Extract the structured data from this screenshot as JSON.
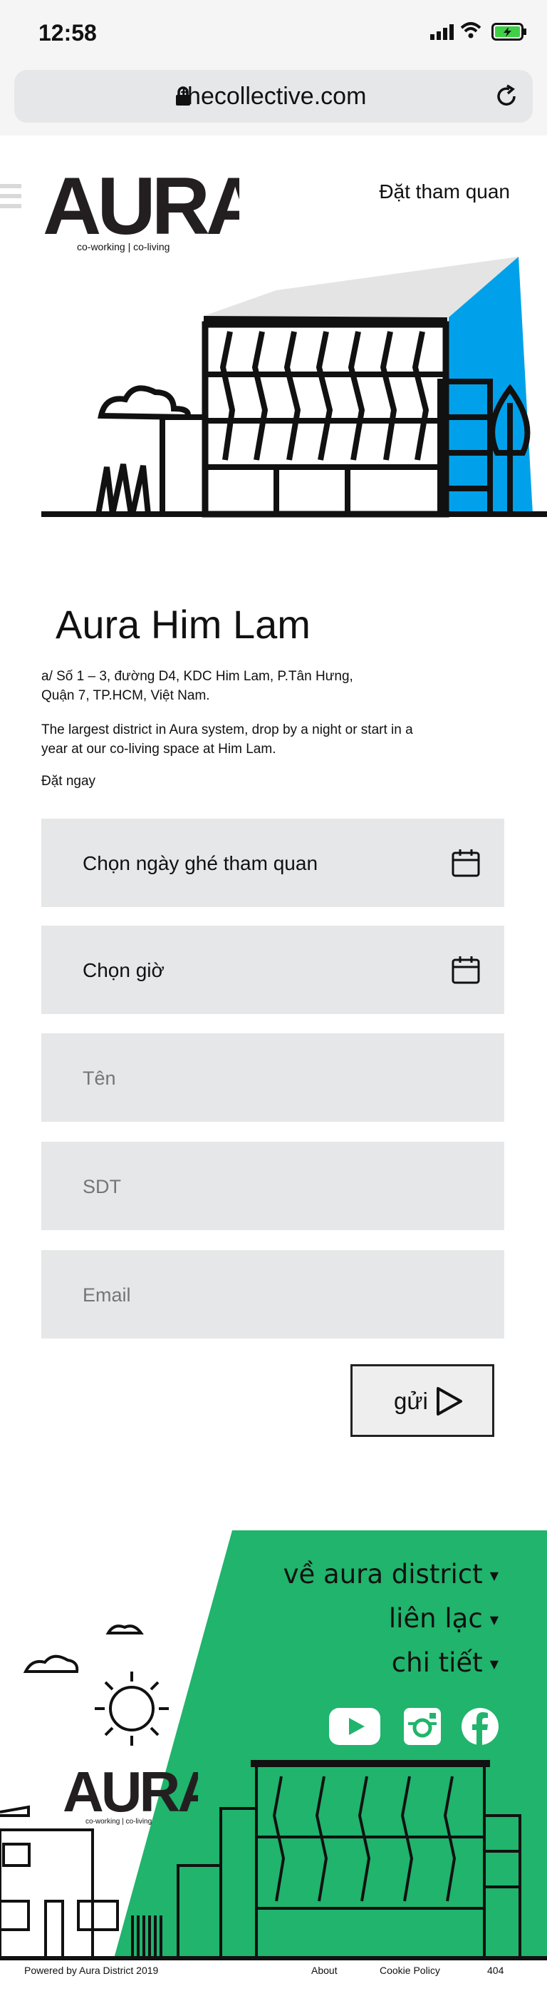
{
  "status": {
    "time": "12:58"
  },
  "browser": {
    "url": "thecollective.com"
  },
  "header": {
    "logo_text": "AURA",
    "tagline": "co-working  |  co-living",
    "tour_link": "Đặt tham quan"
  },
  "location": {
    "title": "Aura Him Lam",
    "address_line1": "a/ Số 1 – 3, đường D4, KDC Him Lam, P.Tân Hưng,",
    "address_line2": "Quận 7, TP.HCM, Việt Nam.",
    "description_line1": "The largest district in Aura system, drop by a night or start in a",
    "description_line2": "year at our co-living space at Him Lam.",
    "book_now": "Đặt ngay"
  },
  "form": {
    "date_label": "Chọn ngày ghé tham quan",
    "time_label": "Chọn giờ",
    "name_placeholder": "Tên",
    "phone_placeholder": "SDT",
    "email_placeholder": "Email",
    "submit_label": "gửi"
  },
  "footer": {
    "nav": [
      "về aura district",
      "liên lạc",
      "chi tiết"
    ],
    "logo_text": "AURA",
    "tagline": "co-working  |  co-living",
    "powered_by": "Powered by Aura District 2019",
    "links": [
      "About",
      "Cookie Policy",
      "404"
    ]
  },
  "colors": {
    "accent_blue": "#00a1ea",
    "footer_green": "#20b46c",
    "field_bg": "#e6e7e8"
  },
  "icons": [
    "lock-icon",
    "reload-icon",
    "calendar-icon",
    "play-arrow-icon",
    "youtube-icon",
    "instagram-icon",
    "facebook-icon"
  ]
}
